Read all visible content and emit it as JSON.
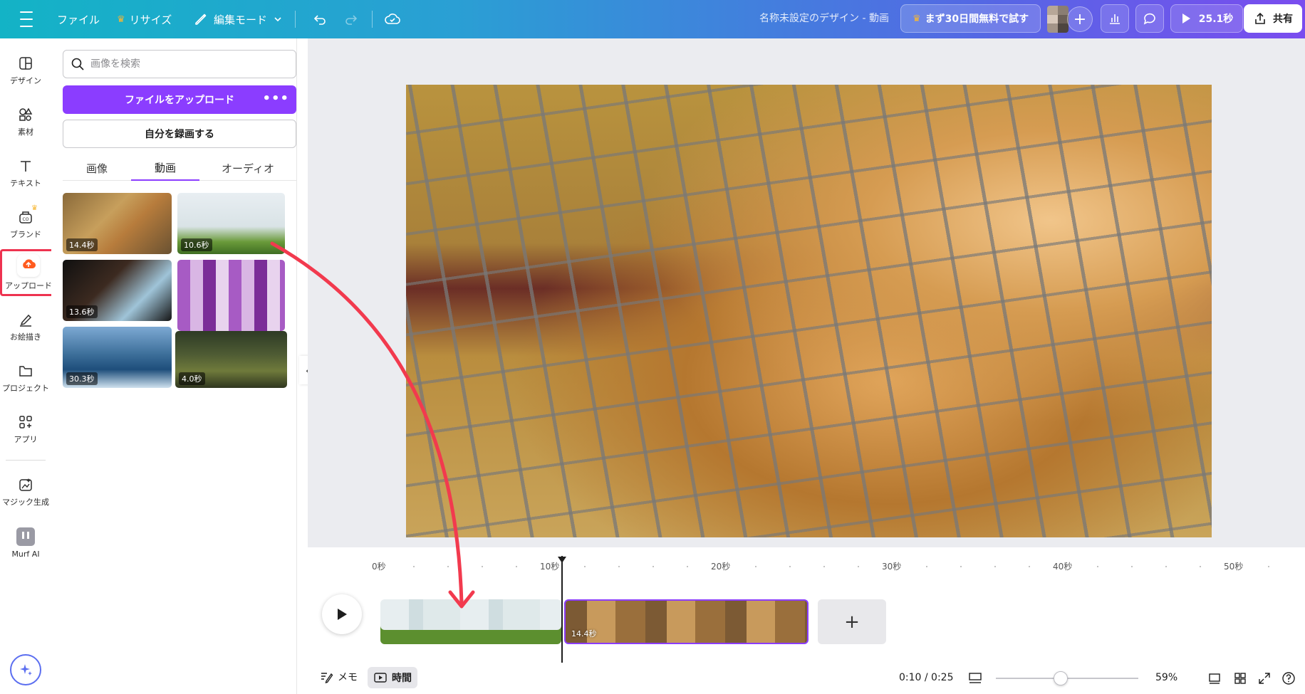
{
  "topbar": {
    "file": "ファイル",
    "resize": "リサイズ",
    "edit_mode": "編集モード",
    "title": "名称未設定のデザイン - 動画",
    "trial": "まず30日間無料で試す",
    "play_duration": "25.1秒",
    "share": "共有"
  },
  "rail": {
    "design": "デザイン",
    "elements": "素材",
    "text": "テキスト",
    "brand": "ブランド",
    "upload": "アップロード",
    "draw": "お絵描き",
    "projects": "プロジェクト",
    "apps": "アプリ",
    "magic": "マジック生成",
    "murf": "Murf AI"
  },
  "panel": {
    "search_placeholder": "画像を検索",
    "upload_button": "ファイルをアップロード",
    "upload_more": "•••",
    "record_button": "自分を録画する",
    "tabs": [
      "画像",
      "動画",
      "オーディオ"
    ],
    "thumbnails": [
      {
        "duration": "14.4秒"
      },
      {
        "duration": "10.6秒"
      },
      {
        "duration": "13.6秒"
      },
      {
        "duration": ""
      },
      {
        "duration": "30.3秒"
      },
      {
        "duration": "4.0秒"
      }
    ]
  },
  "timeline": {
    "ruler": [
      "0秒",
      "10秒",
      "20秒",
      "30秒",
      "40秒",
      "50秒"
    ],
    "clip2_duration": "14.4秒",
    "add": "+"
  },
  "bottombar": {
    "notes": "メモ",
    "time": "時間",
    "clock": "0:10 / 0:25",
    "zoom": "59%",
    "zoom_level": 0.59
  },
  "colors": {
    "accent": "#8b3dff",
    "highlight": "#ee3350",
    "arrow": "#f23a4e"
  }
}
